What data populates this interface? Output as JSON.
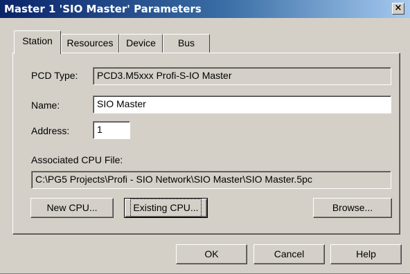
{
  "window": {
    "title": "Master 1 'SIO Master' Parameters",
    "close_glyph": "×"
  },
  "tabs": [
    {
      "label": "Station",
      "active": true
    },
    {
      "label": "Resources",
      "active": false
    },
    {
      "label": "Device",
      "active": false
    },
    {
      "label": "Bus",
      "active": false
    }
  ],
  "station": {
    "pcd_type_label": "PCD Type:",
    "pcd_type_value": "PCD3.M5xxx Profi-S-IO Master",
    "name_label": "Name:",
    "name_value": "SIO Master",
    "address_label": "Address:",
    "address_value": "1",
    "cpu_file_label": "Associated CPU File:",
    "cpu_file_value": "C:\\PG5 Projects\\Profi - SIO Network\\SIO Master\\SIO Master.5pc",
    "new_cpu_label": "New CPU...",
    "existing_cpu_label": "Existing CPU...",
    "browse_label": "Browse..."
  },
  "footer": {
    "ok_label": "OK",
    "cancel_label": "Cancel",
    "help_label": "Help"
  },
  "colors": {
    "title_gradient_start": "#0a246a",
    "title_gradient_end": "#a6caf0",
    "face": "#d4d0c8"
  }
}
